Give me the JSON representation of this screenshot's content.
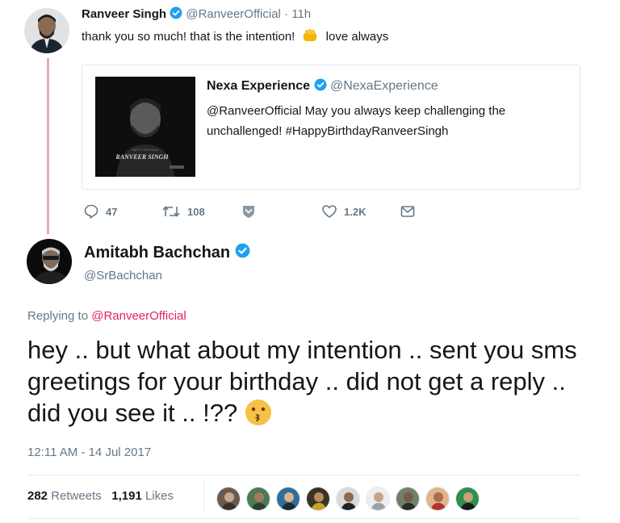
{
  "reply_tweet": {
    "author_name": "Ranveer Singh",
    "author_handle": "@RanveerOfficial",
    "time": "· 11h",
    "text_before_emoji": "thank you so much! that is the intention!",
    "text_after_emoji": "love always",
    "avatar_icon": "person-avatar-icon",
    "quoted": {
      "author_name": "Nexa Experience",
      "author_handle": "@NexaExperience",
      "text": "@RanveerOfficial May you always keep challenging the unchallenged! #HappyBirthdayRanveerSingh",
      "image_caption": "RANVEER SINGH",
      "image_small_text": "HAPPY BIRTHDAY"
    },
    "actions": {
      "replies": "47",
      "retweets": "108",
      "likes": "1.2K"
    }
  },
  "main_tweet": {
    "author_name": "Amitabh Bachchan",
    "author_handle": "@SrBachchan",
    "replying_prefix": "Replying to",
    "replying_to": "@RanveerOfficial",
    "text": "hey .. but what about my intention .. sent you sms greetings for your birthday .. did not get a reply .. did you see it .. !??",
    "timestamp": "12:11 AM - 14 Jul 2017",
    "retweets_count": "282",
    "retweets_label": "Retweets",
    "likes_count": "1,191",
    "likes_label": "Likes"
  },
  "colors": {
    "verified": "#1da1f2",
    "mention": "#e0245e",
    "secondary_text": "#657786",
    "thread_line": "#e8a9bb"
  }
}
